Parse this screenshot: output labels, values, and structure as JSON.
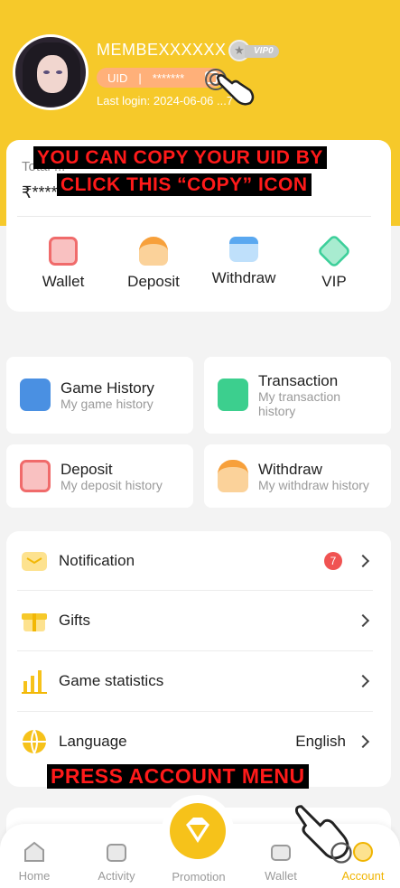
{
  "profile": {
    "name": "MEMBEXXXXXX",
    "vip_level": "VIP0",
    "uid_label": "UID",
    "uid_separator": "|",
    "uid_value": "*******",
    "last_login": "Last login: 2024-06-06 ...7"
  },
  "balance": {
    "label": "Total ...",
    "value": "₹****"
  },
  "annotations": {
    "copy_hint_line1": "YOU CAN COPY YOUR UID BY",
    "copy_hint_line2": "CLICK THIS “COPY” ICON",
    "account_hint": "PRESS ACCOUNT MENU"
  },
  "quick_actions": [
    {
      "label": "Wallet",
      "icon": "wallet-icon",
      "color": "#f06b6b"
    },
    {
      "label": "Deposit",
      "icon": "deposit-icon",
      "color": "#f7a03b"
    },
    {
      "label": "Withdraw",
      "icon": "withdraw-card-icon",
      "color": "#5aa8f0"
    },
    {
      "label": "VIP",
      "icon": "vip-gem-icon",
      "color": "#3ccf9a"
    }
  ],
  "history": [
    {
      "title": "Game History",
      "subtitle": "My game history",
      "icon": "game-history-icon",
      "color": "#4a90e2"
    },
    {
      "title": "Transaction",
      "subtitle": "My transaction history",
      "icon": "transaction-icon",
      "color": "#3ccf8e"
    },
    {
      "title": "Deposit",
      "subtitle": "My deposit history",
      "icon": "deposit-history-icon",
      "color": "#f06b6b"
    },
    {
      "title": "Withdraw",
      "subtitle": "My withdraw history",
      "icon": "withdraw-history-icon",
      "color": "#f7a03b"
    }
  ],
  "menu": {
    "notification": {
      "label": "Notification",
      "badge": "7",
      "icon": "notification-icon"
    },
    "gifts": {
      "label": "Gifts",
      "icon": "gift-icon"
    },
    "game_statistics": {
      "label": "Game statistics",
      "icon": "bar-chart-icon"
    },
    "language": {
      "label": "Language",
      "value": "English",
      "icon": "globe-icon"
    }
  },
  "tabs": {
    "home": "Home",
    "activity": "Activity",
    "promotion": "Promotion",
    "wallet": "Wallet",
    "account": "Account"
  },
  "colors": {
    "brand_yellow": "#f6c92a",
    "accent_orange": "#f0b400",
    "badge_red": "#f05352",
    "annotation_red": "#ff1a1a"
  }
}
